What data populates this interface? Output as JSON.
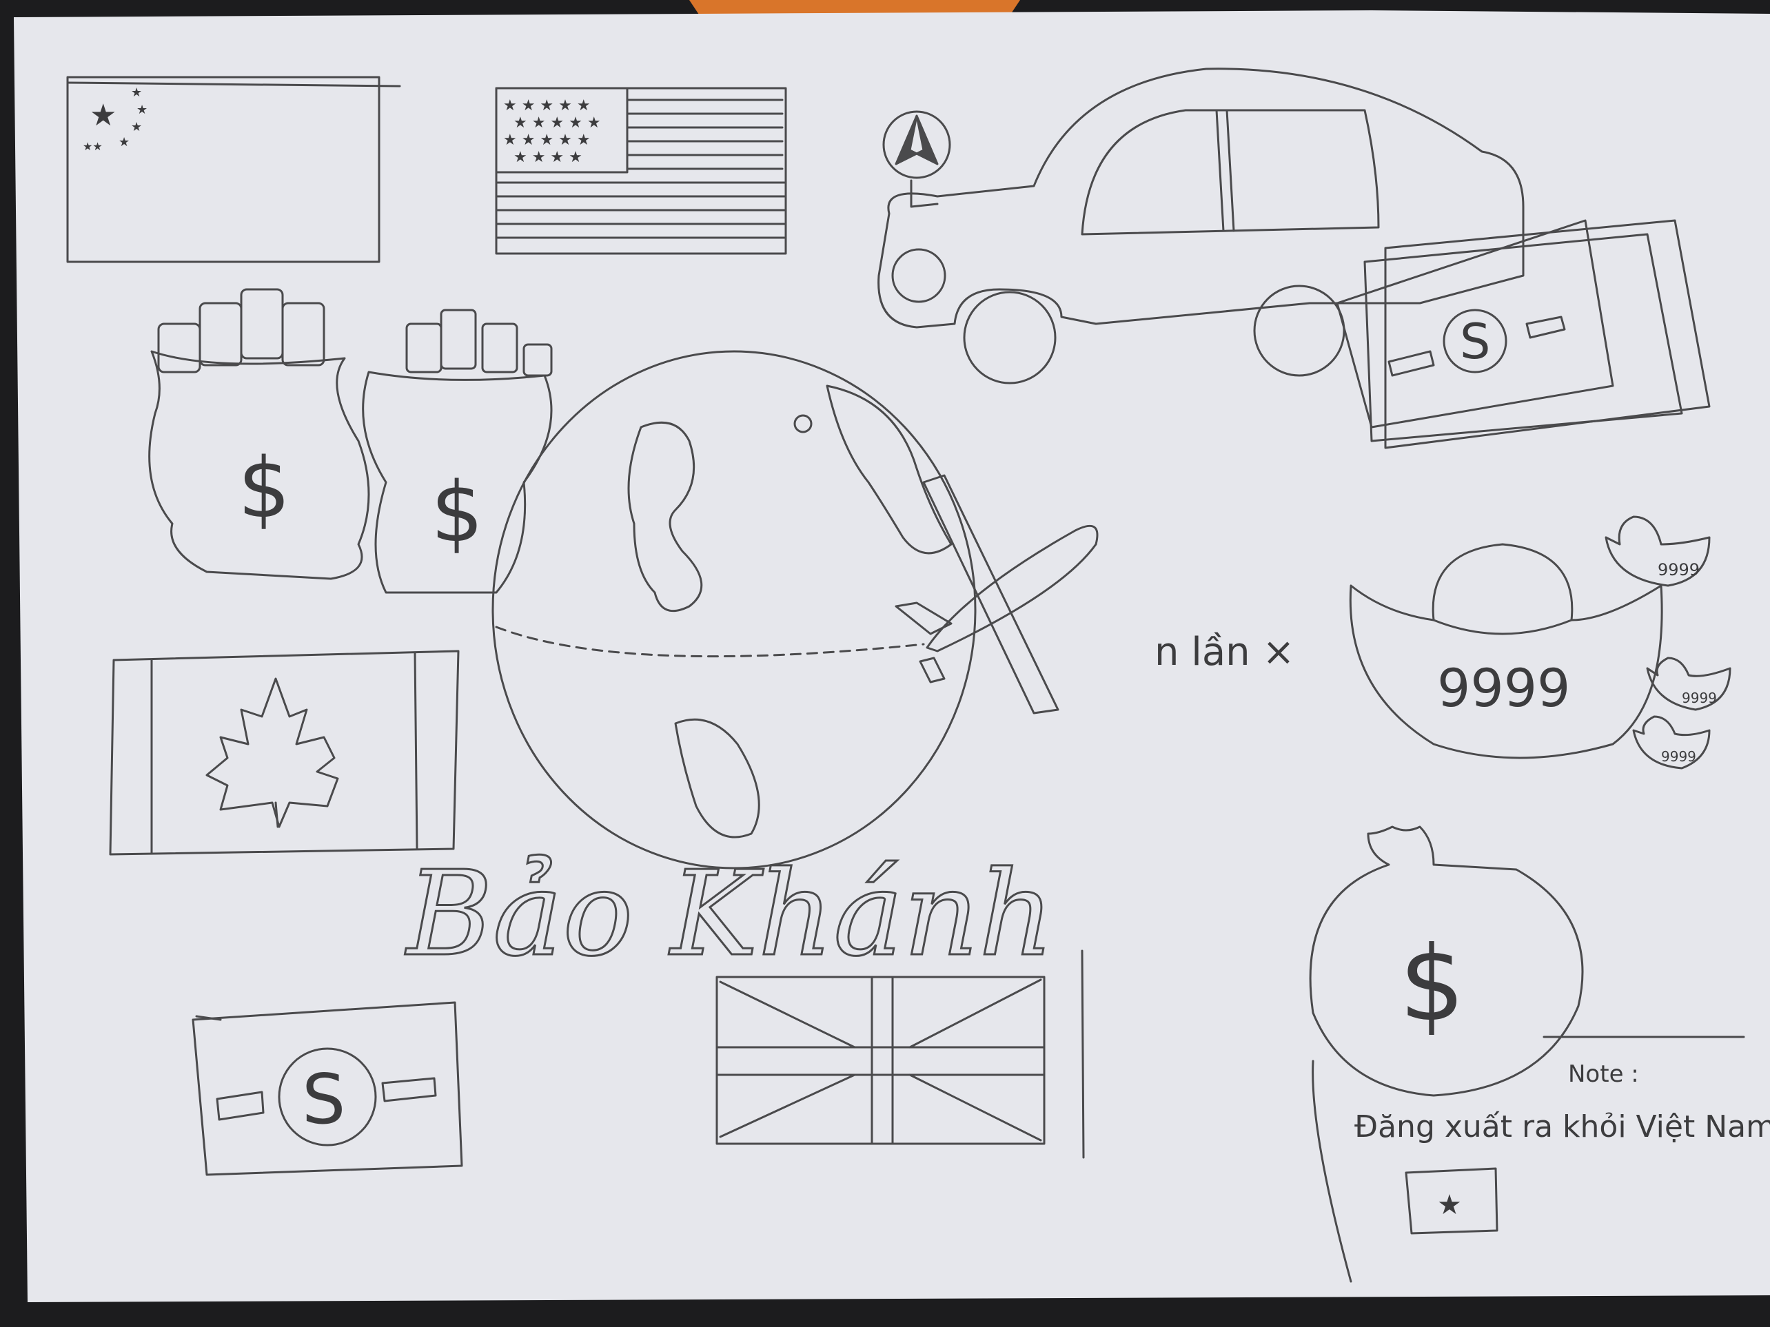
{
  "image": {
    "subject": "pencil-sketch-on-paper",
    "colors": {
      "paper": "#e6e7ec",
      "pencil": "#4a4a4c",
      "background": "#1c1c1e",
      "accent_top": "#d9752a"
    }
  },
  "texts": {
    "name": "Bảo Khánh",
    "multiplier": "n lần ×",
    "gold_big": "9999",
    "gold_small": [
      "9999",
      "9999",
      "9999"
    ],
    "note_label": "Note :",
    "note_text": "Đăng xuất ra khỏi Việt Nam",
    "dollar_sign": "$",
    "s_symbol": "S"
  },
  "icons": {
    "flags": [
      "china-flag-icon",
      "usa-flag-icon",
      "canada-flag-icon",
      "uk-flag-icon",
      "vietnam-flag-icon"
    ],
    "objects": [
      "money-bag-icon",
      "globe-icon",
      "airplane-icon",
      "car-icon",
      "banknote-icon",
      "gold-ingot-icon",
      "mercedes-logo-icon"
    ]
  }
}
